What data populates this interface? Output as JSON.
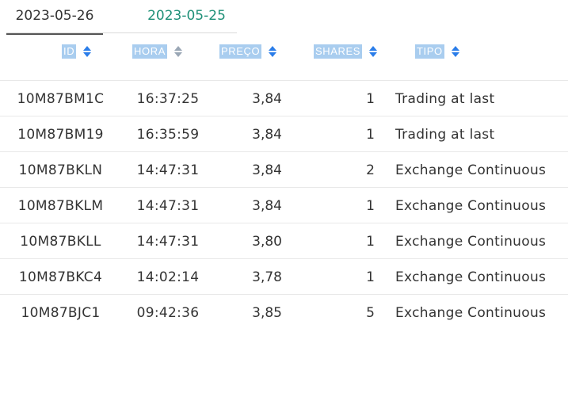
{
  "tabs": [
    {
      "label": "2023-05-26",
      "active": true
    },
    {
      "label": "2023-05-25",
      "active": false
    }
  ],
  "colors": {
    "active_tab_text": "#333333",
    "inactive_tab_text": "#1f9078",
    "header_label_bg": "#a9cdef",
    "sort_icon": "#2b7de9",
    "sort_icon_muted": "#9aa7b5"
  },
  "table": {
    "columns": [
      {
        "key": "id",
        "label": "ID",
        "sort_icon": "sort-icon"
      },
      {
        "key": "hora",
        "label": "HORA",
        "sort_icon": "sort-icon"
      },
      {
        "key": "preco",
        "label": "PREÇO",
        "sort_icon": "sort-icon"
      },
      {
        "key": "shares",
        "label": "SHARES",
        "sort_icon": "sort-icon"
      },
      {
        "key": "tipo",
        "label": "TIPO",
        "sort_icon": "sort-icon"
      }
    ],
    "rows": [
      {
        "id": "10M87BM1C",
        "hora": "16:37:25",
        "preco": "3,84",
        "shares": "1",
        "tipo": "Trading at last"
      },
      {
        "id": "10M87BM19",
        "hora": "16:35:59",
        "preco": "3,84",
        "shares": "1",
        "tipo": "Trading at last"
      },
      {
        "id": "10M87BKLN",
        "hora": "14:47:31",
        "preco": "3,84",
        "shares": "2",
        "tipo": "Exchange Continuous"
      },
      {
        "id": "10M87BKLM",
        "hora": "14:47:31",
        "preco": "3,84",
        "shares": "1",
        "tipo": "Exchange Continuous"
      },
      {
        "id": "10M87BKLL",
        "hora": "14:47:31",
        "preco": "3,80",
        "shares": "1",
        "tipo": "Exchange Continuous"
      },
      {
        "id": "10M87BKC4",
        "hora": "14:02:14",
        "preco": "3,78",
        "shares": "1",
        "tipo": "Exchange Continuous"
      },
      {
        "id": "10M87BJC1",
        "hora": "09:42:36",
        "preco": "3,85",
        "shares": "5",
        "tipo": "Exchange Continuous"
      }
    ]
  }
}
